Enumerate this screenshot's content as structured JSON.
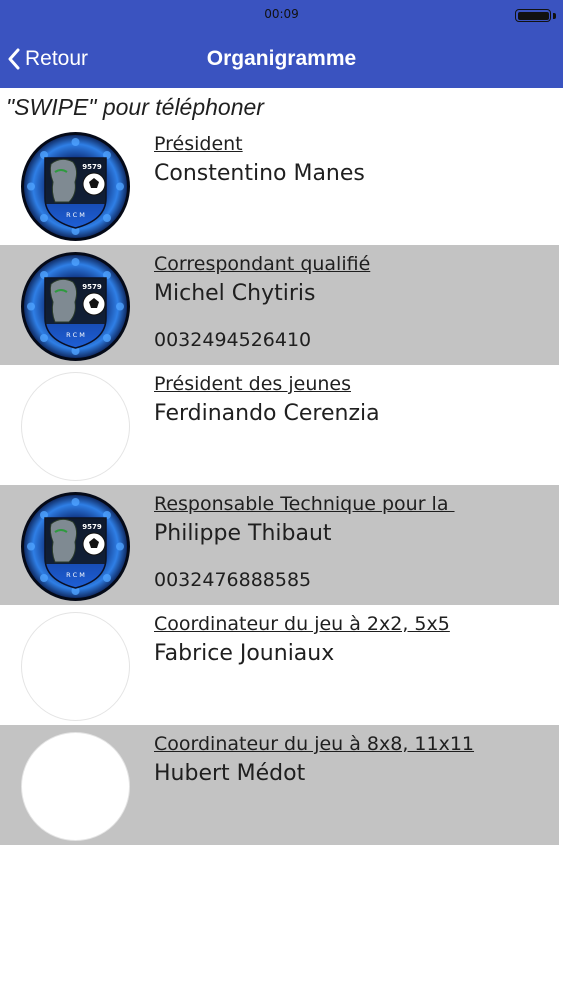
{
  "status_bar": {
    "time": "00:09"
  },
  "nav": {
    "back_label": "Retour",
    "title": "Organigramme"
  },
  "hint": "\"SWIPE\" pour téléphoner",
  "logo": {
    "number": "9579",
    "initials": "R C M"
  },
  "colors": {
    "bar_blue": "#3a53c0",
    "row_shade": "#c3c3c3"
  },
  "contacts": [
    {
      "role": "Président",
      "name": "Constentino Manes",
      "phone": "",
      "avatar": "club-logo"
    },
    {
      "role": "Correspondant qualifié",
      "name": "Michel Chytiris",
      "phone": "0032494526410",
      "avatar": "club-logo"
    },
    {
      "role": "Président des jeunes",
      "name": "Ferdinando Cerenzia",
      "phone": "",
      "avatar": "none"
    },
    {
      "role": "Responsable Technique pour la ",
      "name": "Philippe Thibaut",
      "phone": "0032476888585",
      "avatar": "club-logo"
    },
    {
      "role": "Coordinateur du jeu à 2x2, 5x5",
      "name": "Fabrice Jouniaux",
      "phone": "",
      "avatar": "none"
    },
    {
      "role": "Coordinateur du jeu à 8x8, 11x11",
      "name": "Hubert Médot",
      "phone": "",
      "avatar": "none"
    }
  ]
}
